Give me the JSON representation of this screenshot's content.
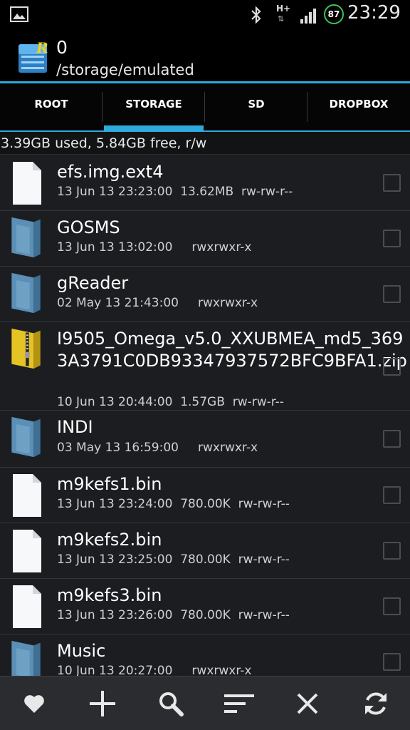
{
  "status_bar": {
    "network_type": "H+",
    "network_arrows": "⇅",
    "battery_level": "87",
    "time": "23:29",
    "icons": [
      "picture-icon",
      "bluetooth-icon",
      "network-icon",
      "signal-icon",
      "battery-icon"
    ]
  },
  "header": {
    "title": "0",
    "path": "/storage/emulated",
    "app_icon": "root-explorer-icon"
  },
  "tabs": [
    {
      "label": "ROOT",
      "selected": false
    },
    {
      "label": "STORAGE",
      "selected": true
    },
    {
      "label": "SD",
      "selected": false
    },
    {
      "label": "DROPBOX",
      "selected": false
    }
  ],
  "usage": "3.39GB used, 5.84GB free, r/w",
  "files": [
    {
      "name": "efs.img.ext4",
      "date": "13 Jun 13 23:23:00",
      "size": "13.62MB",
      "perms": "rw-rw-r--",
      "type": "file"
    },
    {
      "name": "GOSMS",
      "date": "13 Jun 13 13:02:00",
      "size": "",
      "perms": "rwxrwxr-x",
      "type": "folder"
    },
    {
      "name": "gReader",
      "date": "02 May 13 21:43:00",
      "size": "",
      "perms": "rwxrwxr-x",
      "type": "folder"
    },
    {
      "name": "I9505_Omega_v5.0_XXUBMEA_md5_3693A3791C0DB93347937572BFC9BFA1.zip",
      "date": "10 Jun 13 20:44:00",
      "size": "1.57GB",
      "perms": "rw-rw-r--",
      "type": "zip"
    },
    {
      "name": "INDI",
      "date": "03 May 13 16:59:00",
      "size": "",
      "perms": "rwxrwxr-x",
      "type": "folder"
    },
    {
      "name": "m9kefs1.bin",
      "date": "13 Jun 13 23:24:00",
      "size": "780.00K",
      "perms": "rw-rw-r--",
      "type": "file"
    },
    {
      "name": "m9kefs2.bin",
      "date": "13 Jun 13 23:25:00",
      "size": "780.00K",
      "perms": "rw-rw-r--",
      "type": "file"
    },
    {
      "name": "m9kefs3.bin",
      "date": "13 Jun 13 23:26:00",
      "size": "780.00K",
      "perms": "rw-rw-r--",
      "type": "file"
    },
    {
      "name": "Music",
      "date": "10 Jun 13 20:27:00",
      "size": "",
      "perms": "rwxrwxr-x",
      "type": "folder"
    }
  ],
  "bottom_bar": [
    {
      "icon": "heart-icon",
      "name": "favorites-button"
    },
    {
      "icon": "plus-icon",
      "name": "new-button"
    },
    {
      "icon": "search-icon",
      "name": "search-button"
    },
    {
      "icon": "sort-icon",
      "name": "sort-button"
    },
    {
      "icon": "close-icon",
      "name": "close-button"
    },
    {
      "icon": "refresh-icon",
      "name": "refresh-button"
    }
  ],
  "colors": {
    "accent": "#2fa9dc",
    "background": "#1b1d20",
    "folder": "#5b8fb5",
    "zip": "#e6c324",
    "battery_ring": "#39c25a"
  }
}
